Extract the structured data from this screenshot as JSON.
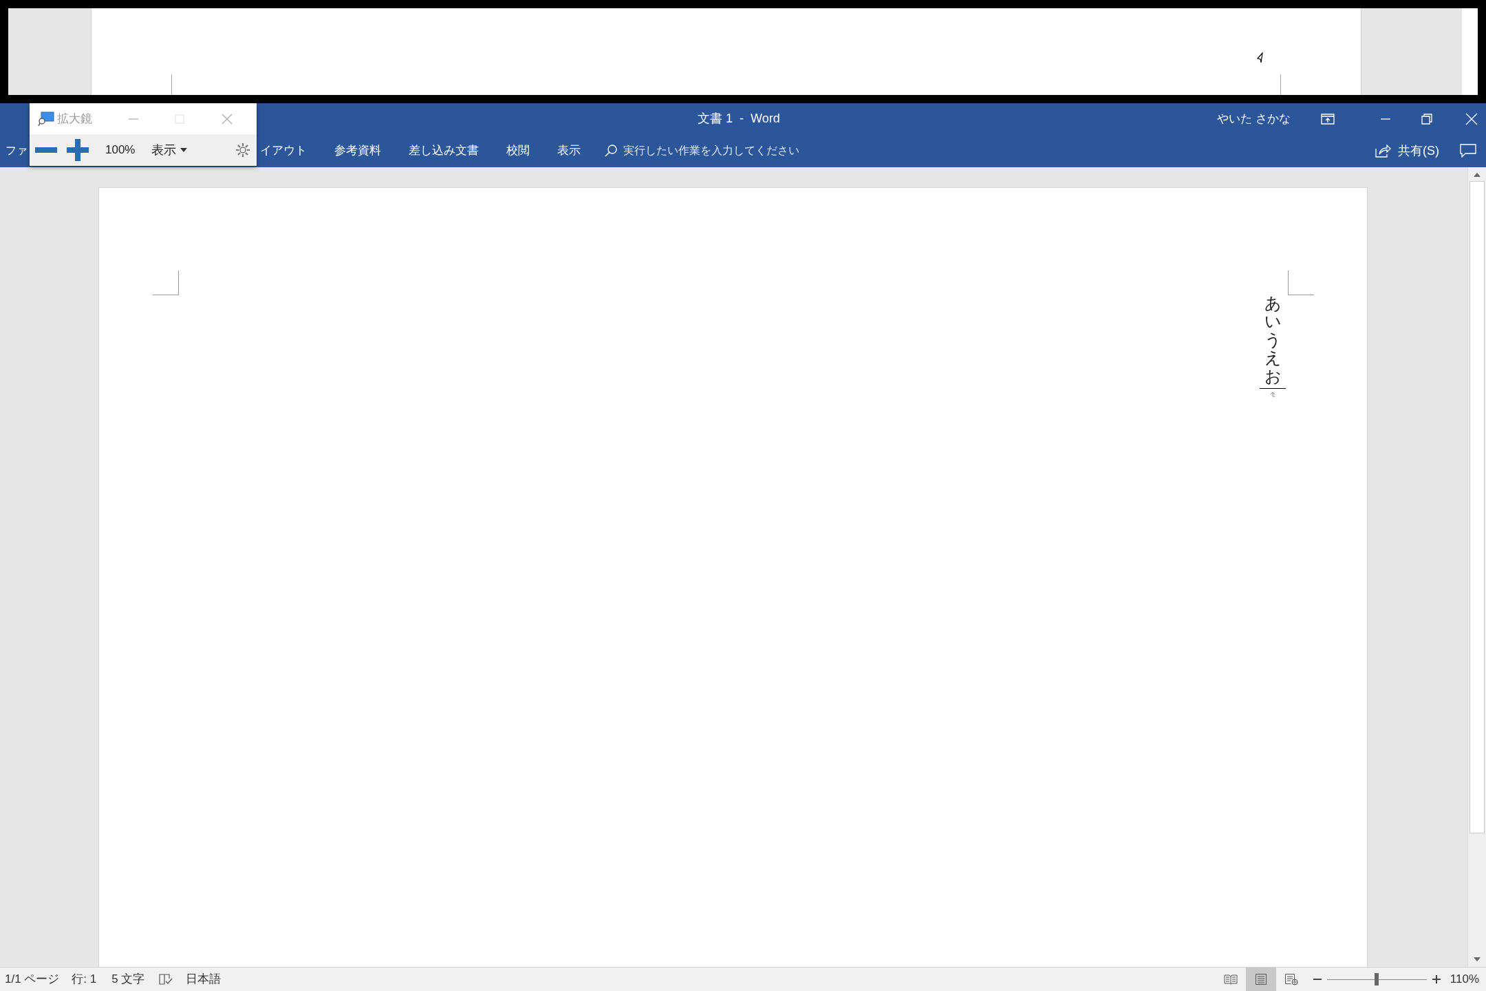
{
  "magnifier": {
    "title": "拡大鏡",
    "zoom": "100%",
    "view_menu": "表示"
  },
  "window": {
    "title": "文書 1  -  Word",
    "user": "やいた さかな",
    "share": "共有(S)"
  },
  "ribbon_tabs": [
    {
      "label": "ファ"
    },
    {
      "label": "イアウト"
    },
    {
      "label": "参考資料"
    },
    {
      "label": "差し込み文書"
    },
    {
      "label": "校閲"
    },
    {
      "label": "表示"
    }
  ],
  "tell_me": {
    "placeholder": "実行したい作業を入力してください"
  },
  "document": {
    "text": "あいうえお"
  },
  "status_bar": {
    "page": "1/1 ページ",
    "line": "行: 1",
    "chars": "5 文字",
    "language": "日本語",
    "views": [
      {
        "kind": "read",
        "selected": false
      },
      {
        "kind": "print",
        "selected": true
      },
      {
        "kind": "web",
        "selected": false
      }
    ],
    "zoom": {
      "level": 0.5,
      "reading": "110%"
    }
  }
}
